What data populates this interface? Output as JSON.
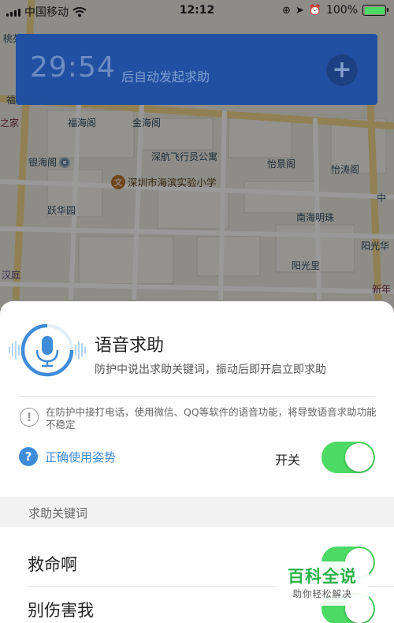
{
  "status_bar": {
    "carrier": "中国移动",
    "time": "12:12",
    "battery_percent": "100%",
    "battery_level": 1.0
  },
  "map": {
    "labels": [
      "桃苑",
      "福海阁",
      "金海阁",
      "深航飞行员公寓",
      "深圳市海滨实验小学",
      "银海阁",
      "怡景阁",
      "怡涛阁",
      "跃华园",
      "南海明珠",
      "阳光里",
      "阳光华",
      "汉庭",
      "新年",
      "之家",
      "福",
      "中"
    ]
  },
  "banner": {
    "countdown": "29:54",
    "text": "后自动发起求助",
    "plus_symbol": "+"
  },
  "feature": {
    "title": "语音求助",
    "description": "防护中说出求助关键词，振动后即开启立即求助",
    "warning": "在防护中接打电话，使用微信、QQ等软件的语音功能，将导致语音求助功能不稳定",
    "warning_symbol": "!",
    "help_symbol": "?",
    "help_link": "正确使用姿势",
    "switch_label": "开关",
    "switch_on": true
  },
  "keywords": {
    "section_title": "求助关键词",
    "items": [
      {
        "text": "救命啊",
        "on": true
      },
      {
        "text": "别伤害我",
        "on": true
      }
    ]
  },
  "watermark": {
    "title": "百科全说",
    "subtitle": "助你轻松解决"
  },
  "colors": {
    "banner_bg": "#1f4fa3",
    "toggle_on": "#4cd964",
    "link_blue": "#3f8cd9",
    "watermark_green": "#2bb24c"
  }
}
